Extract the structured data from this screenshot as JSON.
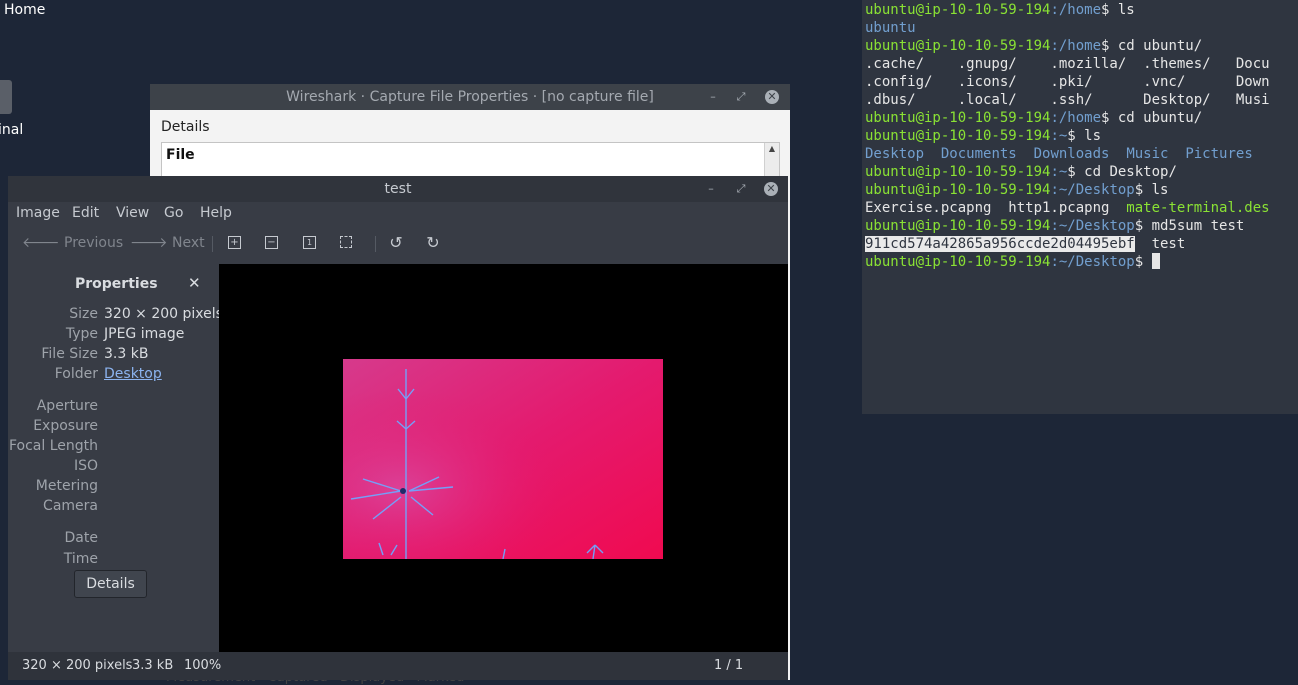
{
  "desktop": {
    "home_label": "Home",
    "terminal_label": "inal"
  },
  "terminal": {
    "lines": [
      {
        "prompt": "ubuntu@ip-10-10-59-194",
        "path": ":/home",
        "cmd": "$ ls"
      },
      {
        "out": "ubuntu"
      },
      {
        "prompt": "ubuntu@ip-10-10-59-194",
        "path": ":/home",
        "cmd": "$ cd ubuntu/"
      },
      {
        "out": ".cache/    .gnupg/    .mozilla/  .themes/   Docu"
      },
      {
        "out": ".config/   .icons/    .pki/      .vnc/      Down"
      },
      {
        "out": ".dbus/     .local/    .ssh/      Desktop/   Musi"
      },
      {
        "prompt": "ubuntu@ip-10-10-59-194",
        "path": ":/home",
        "cmd": "$ cd ubuntu/"
      },
      {
        "prompt": "ubuntu@ip-10-10-59-194",
        "path": ":~",
        "cmd": "$ ls"
      },
      {
        "out": "Desktop  Documents  Downloads  Music  Pictures"
      },
      {
        "prompt": "ubuntu@ip-10-10-59-194",
        "path": ":~",
        "cmd": "$ cd Desktop/"
      },
      {
        "prompt": "ubuntu@ip-10-10-59-194",
        "path": ":~/Desktop",
        "cmd": "$ ls"
      },
      {
        "out": "Exercise.pcapng  http1.pcapng  mate-terminal.des"
      },
      {
        "prompt": "ubuntu@ip-10-10-59-194",
        "path": ":~/Desktop",
        "cmd": "$ md5sum test"
      },
      {
        "out": "911cd574a42865a956ccde2d04495ebf  test"
      },
      {
        "prompt": "ubuntu@ip-10-10-59-194",
        "path": ":~/Desktop",
        "cmd": "$ "
      }
    ],
    "ls_home_items": [
      "Desktop",
      "Documents",
      "Downloads",
      "Music",
      "Pictures"
    ],
    "ls_desktop": {
      "plain": "Exercise.pcapng  http1.pcapng  ",
      "green": "mate-terminal.des"
    },
    "md5_hash": "911cd574a42865a956ccde2d04495ebf",
    "md5_file": "  test"
  },
  "wireshark": {
    "title": "Wireshark · Capture File Properties · [no capture file]",
    "details_label": "Details",
    "file_heading": "File",
    "bottom_text": "Measurement   Captured   Displayed   Marked"
  },
  "eog": {
    "title": "test",
    "menu": [
      "Image",
      "Edit",
      "View",
      "Go",
      "Help"
    ],
    "toolbar": {
      "previous": "Previous",
      "next": "Next"
    },
    "properties": {
      "header": "Properties",
      "rows": [
        {
          "label": "Size",
          "value": "320 × 200 pixels"
        },
        {
          "label": "Type",
          "value": "JPEG image"
        },
        {
          "label": "File Size",
          "value": "3.3 kB"
        },
        {
          "label": "Folder",
          "value": "Desktop"
        }
      ],
      "exif_labels": [
        "Aperture",
        "Exposure",
        "Focal Length",
        "ISO",
        "Metering",
        "Camera"
      ],
      "date_labels": [
        "Date",
        "Time"
      ],
      "details_button": "Details"
    },
    "status": {
      "dimensions": "320 × 200 pixels",
      "size": "3.3 kB",
      "zoom": "100%",
      "position": "1 / 1"
    }
  },
  "colors": {
    "prompt_green": "#8ae234",
    "path_blue": "#729fcf",
    "image_magenta": "#ea0d5c",
    "fractal_blue": "#6fa6ff"
  }
}
